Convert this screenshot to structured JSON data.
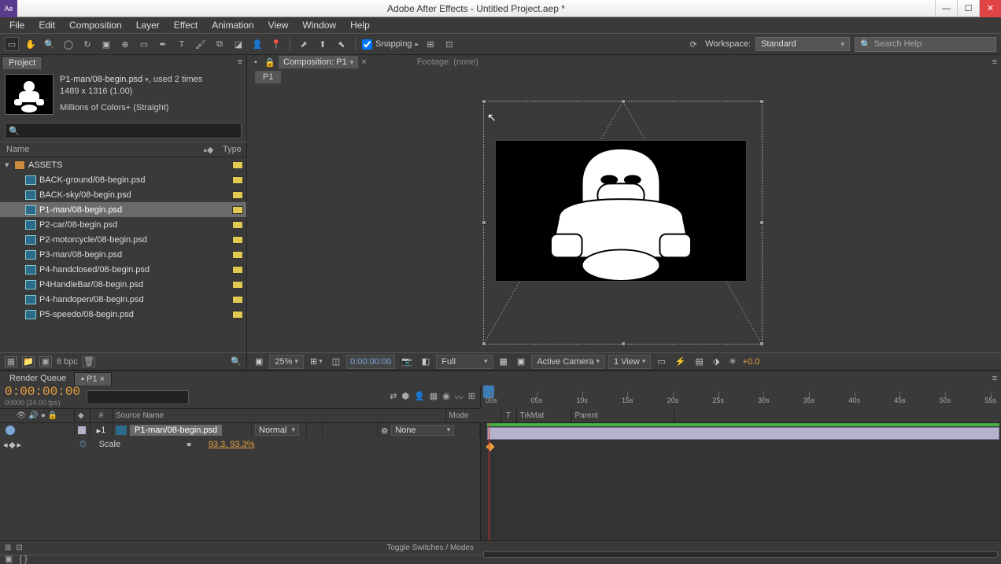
{
  "titlebar": {
    "title": "Adobe After Effects - Untitled Project.aep *"
  },
  "menu": [
    "File",
    "Edit",
    "Composition",
    "Layer",
    "Effect",
    "Animation",
    "View",
    "Window",
    "Help"
  ],
  "toolbar": {
    "snapping": "Snapping",
    "workspace_label": "Workspace:",
    "workspace_value": "Standard",
    "search_placeholder": "Search Help"
  },
  "project": {
    "tab": "Project",
    "asset_name": "P1-man/08-begin.psd",
    "asset_used": ", used 2 times",
    "asset_dims": "1489 x 1316 (1.00)",
    "asset_colors": "Millions of Colors+ (Straight)",
    "col_name": "Name",
    "col_type": "Type",
    "folder": "ASSETS",
    "items": [
      "BACK-ground/08-begin.psd",
      "BACK-sky/08-begin.psd",
      "P1-man/08-begin.psd",
      "P2-car/08-begin.psd",
      "P2-motorcycle/08-begin.psd",
      "P3-man/08-begin.psd",
      "P4-handclosed/08-begin.psd",
      "P4HandleBar/08-begin.psd",
      "P4-handopen/08-begin.psd",
      "P5-speedo/08-begin.psd"
    ],
    "selected_index": 2,
    "bpc": "8 bpc"
  },
  "comp": {
    "tab_label": "Composition: P1",
    "footage_label": "Footage: (none)",
    "crumb": "P1",
    "footer": {
      "zoom": "25%",
      "timecode": "0:00:00:00",
      "res": "Full",
      "camera": "Active Camera",
      "views": "1 View",
      "exposure": "+0.0"
    }
  },
  "timeline": {
    "tab_rq": "Render Queue",
    "tab_comp": "P1",
    "timecode": "0:00:00:00",
    "timecode_sub": "00000 (24.00 fps)",
    "ticks": [
      "00s",
      "05s",
      "10s",
      "15s",
      "20s",
      "25s",
      "30s",
      "35s",
      "40s",
      "45s",
      "50s",
      "55s"
    ],
    "cols": {
      "num": "#",
      "src": "Source Name",
      "mode": "Mode",
      "t": "T",
      "trk": "TrkMat",
      "parent": "Parent"
    },
    "layer": {
      "num": "1",
      "name": "P1-man/08-begin.psd",
      "mode": "Normal",
      "parent": "None"
    },
    "prop": {
      "name": "Scale",
      "value": "93.3, 93.3%"
    },
    "toggle": "Toggle Switches / Modes"
  }
}
